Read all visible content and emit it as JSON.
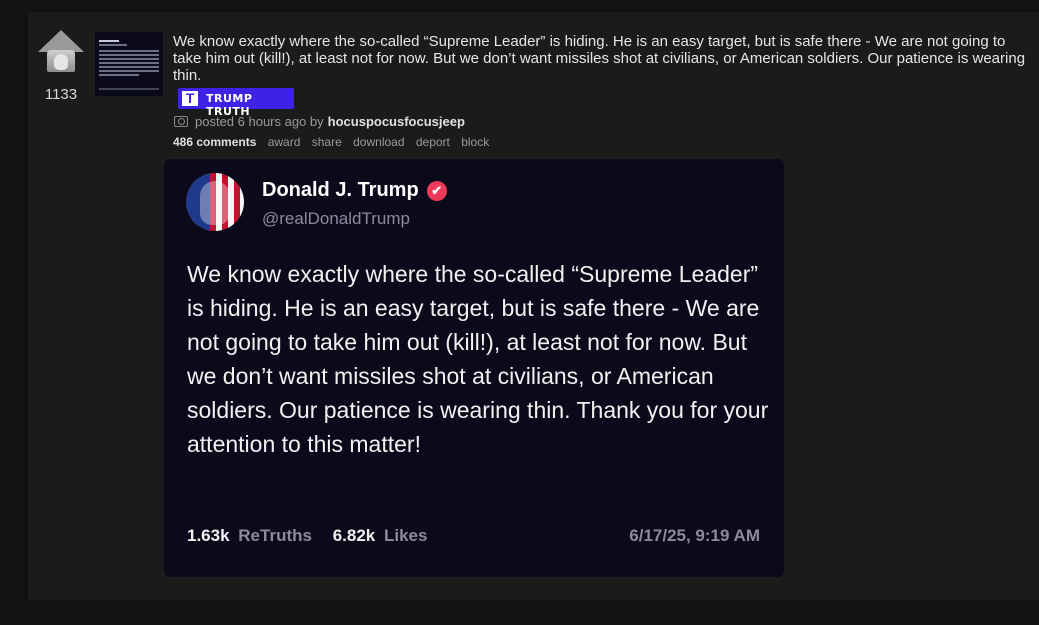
{
  "post": {
    "score": "1133",
    "title": "We know exactly where the so-called “Supreme Leader” is hiding. He is an easy target, but is safe there - We are not going to take him out (kill!), at least not for now. But we don’t want missiles shot at civilians, or American soldiers. Our patience is wearing thin.",
    "flair": {
      "logo": "T",
      "text": "TRUMP TRUTH"
    },
    "meta": {
      "posted": "posted 6 hours ago by",
      "user": "hocuspocusfocusjeep"
    },
    "actions": {
      "comments": "486 comments",
      "award": "award",
      "share": "share",
      "download": "download",
      "deport": "deport",
      "block": "block"
    }
  },
  "card": {
    "name": "Donald J. Trump",
    "verified_icon": "✔",
    "handle": "@realDonaldTrump",
    "body": "We know exactly where the so-called “Supreme Leader” is hiding. He is an easy target, but is safe there - We are not going to take him out (kill!), at least not for now. But we don’t want missiles shot at civilians, or American soldiers. Our patience is wearing thin. Thank you for your attention to this matter!",
    "retruths_count": "1.63k",
    "retruths_label": "ReTruths",
    "likes_count": "6.82k",
    "likes_label": "Likes",
    "date": "6/17/25, 9:19 AM"
  },
  "colors": {
    "background": "#111312",
    "panel": "#1a1c1c",
    "card": "#0b0a1b",
    "flair": "#3d23e6",
    "verified": "#ec3b58"
  }
}
